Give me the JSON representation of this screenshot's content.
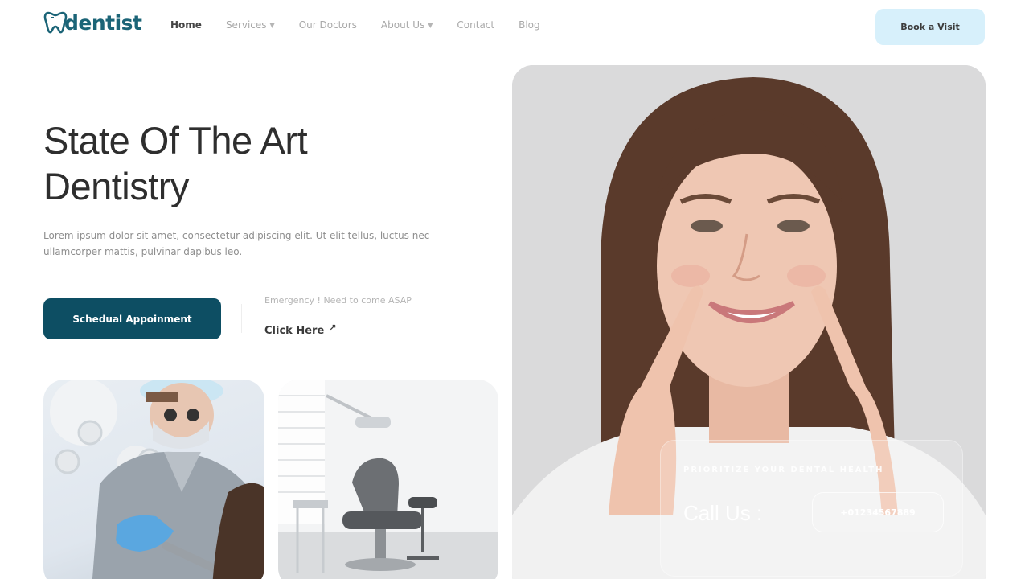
{
  "brand": {
    "name": "dentist"
  },
  "nav": {
    "items": [
      {
        "label": "Home",
        "active": true,
        "has_dropdown": false
      },
      {
        "label": "Services",
        "active": false,
        "has_dropdown": true
      },
      {
        "label": "Our Doctors",
        "active": false,
        "has_dropdown": false
      },
      {
        "label": "About Us",
        "active": false,
        "has_dropdown": true
      },
      {
        "label": "Contact",
        "active": false,
        "has_dropdown": false
      },
      {
        "label": "Blog",
        "active": false,
        "has_dropdown": false
      }
    ],
    "cta_label": "Book a Visit"
  },
  "hero": {
    "title": "State Of The Art Dentistry",
    "description": "Lorem ipsum dolor sit amet, consectetur adipiscing elit. Ut elit tellus, luctus nec ullamcorper mattis, pulvinar dapibus leo.",
    "primary_button": "Schedual Appoinment",
    "emergency_text": "Emergency ! Need to come ASAP",
    "emergency_link": "Click Here",
    "emergency_icon": "arrow-up-right-icon"
  },
  "contact_card": {
    "tagline": "PRIORITIZE YOUR DENTAL HEALTH",
    "call_label": "Call Us :",
    "phone": "+01234567889"
  },
  "colors": {
    "brand": "#1b6477",
    "primary_button": "#0d4e63",
    "cta_bg": "#d7f0fb"
  }
}
